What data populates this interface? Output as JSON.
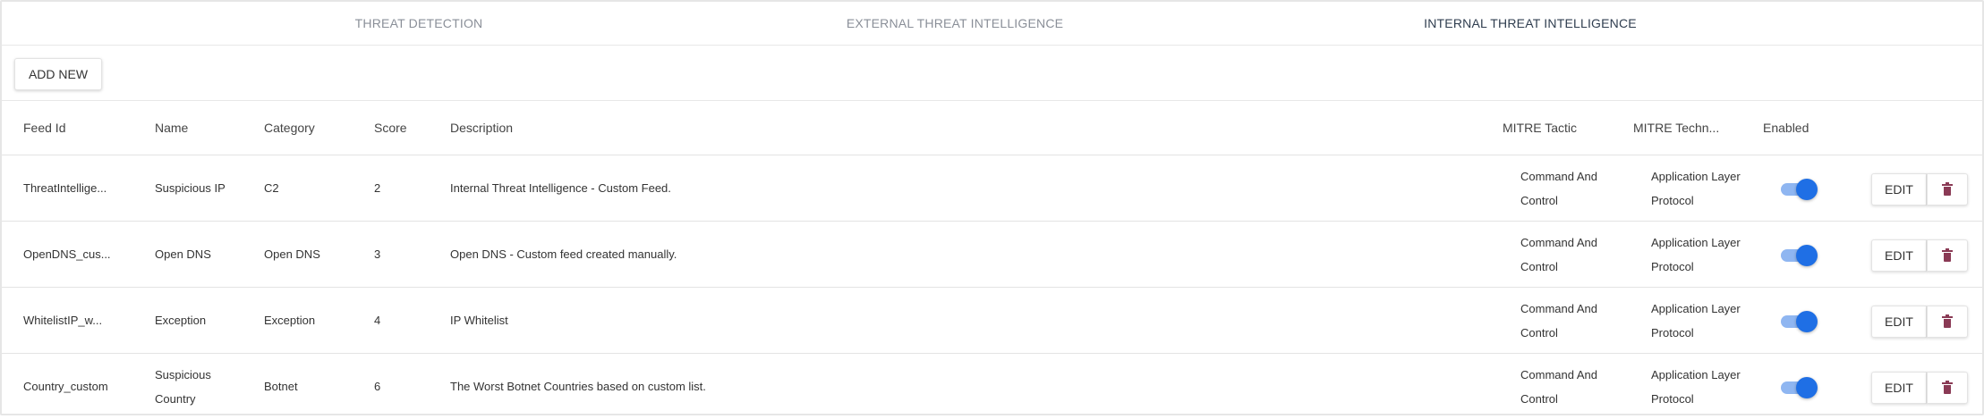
{
  "tabs": [
    {
      "label": "THREAT DETECTION"
    },
    {
      "label": "EXTERNAL THREAT INTELLIGENCE"
    },
    {
      "label": "INTERNAL THREAT INTELLIGENCE",
      "active": true
    }
  ],
  "toolbar": {
    "add_new_label": "ADD NEW"
  },
  "table": {
    "headers": [
      "Feed Id",
      "Name",
      "Category",
      "Score",
      "Description",
      "MITRE Tactic",
      "MITRE Techn...",
      "Enabled"
    ],
    "rows": [
      {
        "feed_id": "ThreatIntellige...",
        "name": "Suspicious IP",
        "category": "C2",
        "score": "2",
        "description": "Internal Threat Intelligence - Custom Feed.",
        "tactic": "Command And Control",
        "technique": "Application Layer Protocol",
        "enabled": true
      },
      {
        "feed_id": "OpenDNS_cus...",
        "name": "Open DNS",
        "category": "Open DNS",
        "score": "3",
        "description": "Open DNS - Custom feed created manually.",
        "tactic": "Command And Control",
        "technique": "Application Layer Protocol",
        "enabled": true
      },
      {
        "feed_id": "WhitelistIP_w...",
        "name": "Exception",
        "category": "Exception",
        "score": "4",
        "description": "IP Whitelist",
        "tactic": "Command And Control",
        "technique": "Application Layer Protocol",
        "enabled": true
      },
      {
        "feed_id": "Country_custom",
        "name": "Suspicious Country",
        "category": "Botnet",
        "score": "6",
        "description": "The Worst Botnet Countries based on custom list.",
        "tactic": "Command And Control",
        "technique": "Application Layer Protocol",
        "enabled": true
      }
    ]
  },
  "row_actions": {
    "edit_label": "EDIT",
    "delete_icon": "trash-icon"
  },
  "colors": {
    "accent": "#1f6fe5",
    "toggle_track": "#8fb6f1",
    "delete_icon": "#8a3a55"
  }
}
